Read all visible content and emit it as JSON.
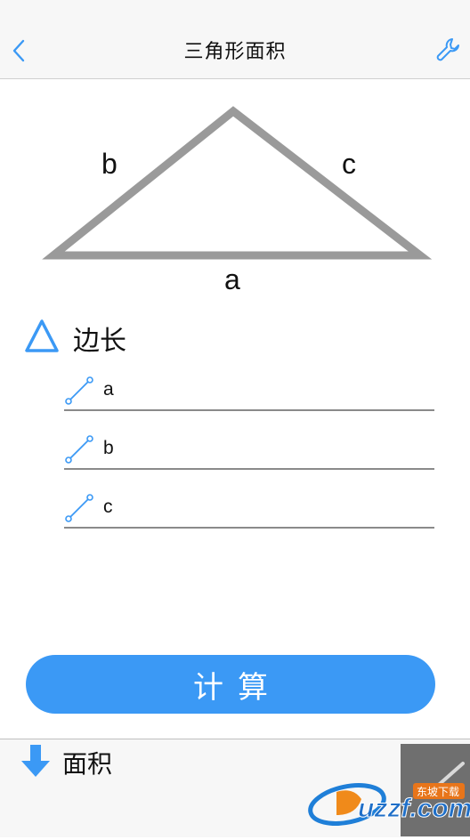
{
  "navbar": {
    "title": "三角形面积",
    "back_icon": "chevron-left-icon",
    "tool_icon": "wrench-icon"
  },
  "diagram": {
    "label_a": "a",
    "label_b": "b",
    "label_c": "c"
  },
  "sides_section": {
    "icon": "triangle-outline-icon",
    "title": "边长",
    "fields": [
      {
        "icon": "ruler-line-icon",
        "placeholder": "a"
      },
      {
        "icon": "ruler-line-icon",
        "placeholder": "b"
      },
      {
        "icon": "ruler-line-icon",
        "placeholder": "c"
      }
    ]
  },
  "calculate_button": {
    "label": "计算"
  },
  "result_section": {
    "icon": "arrow-down-icon",
    "title": "面积"
  },
  "edit_button": {
    "icon": "pencil-icon"
  },
  "watermark": {
    "text": "uzzf.com",
    "tag": "东坡下载"
  },
  "colors": {
    "accent": "#3b99f5",
    "triangle_stroke": "#9a9a9a",
    "navbar_bg": "#f7f7f7",
    "edit_button_bg": "#6f6f6f"
  }
}
